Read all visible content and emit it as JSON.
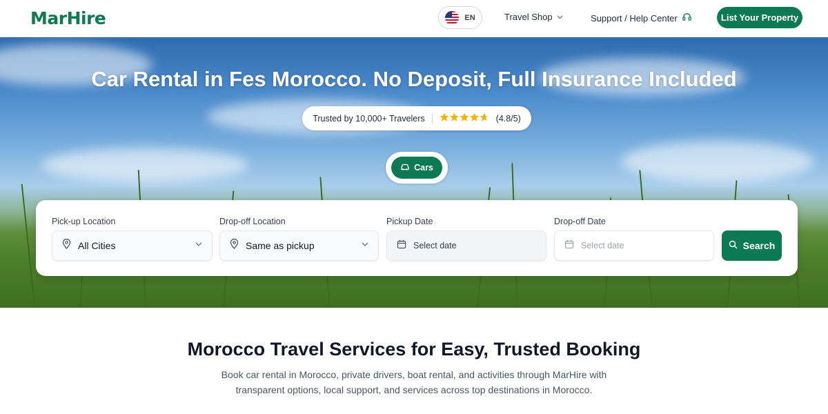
{
  "header": {
    "logo_text": "MarHire",
    "language": {
      "code": "EN",
      "flag_icon": "us-flag-icon"
    },
    "nav": {
      "travel_shop": "Travel Shop",
      "support": "Support / Help Center"
    },
    "list_property": "List Your Property"
  },
  "hero": {
    "title": "Car Rental in Fes Morocco. No Deposit, Full Insurance Included",
    "trust": {
      "text": "Trusted by 10,000+ Travelers",
      "rating": 4.8,
      "rating_text": "(4.8/5)"
    },
    "category_tab": "Cars"
  },
  "search": {
    "pickup_location": {
      "label": "Pick-up Location",
      "value": "All Cities"
    },
    "dropoff_location": {
      "label": "Drop-off Location",
      "value": "Same as pickup"
    },
    "pickup_date": {
      "label": "Pickup Date",
      "placeholder": "Select date"
    },
    "dropoff_date": {
      "label": "Drop-off Date",
      "placeholder": "Select date"
    },
    "button": "Search"
  },
  "section": {
    "title": "Morocco Travel Services for Easy, Trusted Booking",
    "description": "Book car rental in Morocco, private drivers, boat rental, and activities through MarHire with transparent options, local support, and services across top destinations in Morocco."
  },
  "colors": {
    "brand_green": "#0e7a55",
    "star_gold": "#f5b301"
  }
}
